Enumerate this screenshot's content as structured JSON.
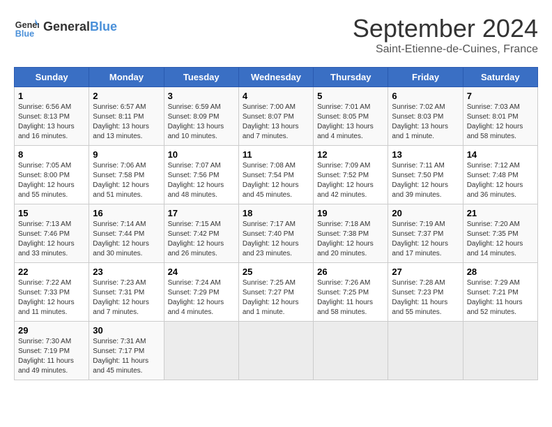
{
  "header": {
    "logo_general": "General",
    "logo_blue": "Blue",
    "title": "September 2024",
    "subtitle": "Saint-Etienne-de-Cuines, France"
  },
  "calendar": {
    "weekdays": [
      "Sunday",
      "Monday",
      "Tuesday",
      "Wednesday",
      "Thursday",
      "Friday",
      "Saturday"
    ],
    "weeks": [
      [
        {
          "day": "1",
          "info": "Sunrise: 6:56 AM\nSunset: 8:13 PM\nDaylight: 13 hours\nand 16 minutes."
        },
        {
          "day": "2",
          "info": "Sunrise: 6:57 AM\nSunset: 8:11 PM\nDaylight: 13 hours\nand 13 minutes."
        },
        {
          "day": "3",
          "info": "Sunrise: 6:59 AM\nSunset: 8:09 PM\nDaylight: 13 hours\nand 10 minutes."
        },
        {
          "day": "4",
          "info": "Sunrise: 7:00 AM\nSunset: 8:07 PM\nDaylight: 13 hours\nand 7 minutes."
        },
        {
          "day": "5",
          "info": "Sunrise: 7:01 AM\nSunset: 8:05 PM\nDaylight: 13 hours\nand 4 minutes."
        },
        {
          "day": "6",
          "info": "Sunrise: 7:02 AM\nSunset: 8:03 PM\nDaylight: 13 hours\nand 1 minute."
        },
        {
          "day": "7",
          "info": "Sunrise: 7:03 AM\nSunset: 8:01 PM\nDaylight: 12 hours\nand 58 minutes."
        }
      ],
      [
        {
          "day": "8",
          "info": "Sunrise: 7:05 AM\nSunset: 8:00 PM\nDaylight: 12 hours\nand 55 minutes."
        },
        {
          "day": "9",
          "info": "Sunrise: 7:06 AM\nSunset: 7:58 PM\nDaylight: 12 hours\nand 51 minutes."
        },
        {
          "day": "10",
          "info": "Sunrise: 7:07 AM\nSunset: 7:56 PM\nDaylight: 12 hours\nand 48 minutes."
        },
        {
          "day": "11",
          "info": "Sunrise: 7:08 AM\nSunset: 7:54 PM\nDaylight: 12 hours\nand 45 minutes."
        },
        {
          "day": "12",
          "info": "Sunrise: 7:09 AM\nSunset: 7:52 PM\nDaylight: 12 hours\nand 42 minutes."
        },
        {
          "day": "13",
          "info": "Sunrise: 7:11 AM\nSunset: 7:50 PM\nDaylight: 12 hours\nand 39 minutes."
        },
        {
          "day": "14",
          "info": "Sunrise: 7:12 AM\nSunset: 7:48 PM\nDaylight: 12 hours\nand 36 minutes."
        }
      ],
      [
        {
          "day": "15",
          "info": "Sunrise: 7:13 AM\nSunset: 7:46 PM\nDaylight: 12 hours\nand 33 minutes."
        },
        {
          "day": "16",
          "info": "Sunrise: 7:14 AM\nSunset: 7:44 PM\nDaylight: 12 hours\nand 30 minutes."
        },
        {
          "day": "17",
          "info": "Sunrise: 7:15 AM\nSunset: 7:42 PM\nDaylight: 12 hours\nand 26 minutes."
        },
        {
          "day": "18",
          "info": "Sunrise: 7:17 AM\nSunset: 7:40 PM\nDaylight: 12 hours\nand 23 minutes."
        },
        {
          "day": "19",
          "info": "Sunrise: 7:18 AM\nSunset: 7:38 PM\nDaylight: 12 hours\nand 20 minutes."
        },
        {
          "day": "20",
          "info": "Sunrise: 7:19 AM\nSunset: 7:37 PM\nDaylight: 12 hours\nand 17 minutes."
        },
        {
          "day": "21",
          "info": "Sunrise: 7:20 AM\nSunset: 7:35 PM\nDaylight: 12 hours\nand 14 minutes."
        }
      ],
      [
        {
          "day": "22",
          "info": "Sunrise: 7:22 AM\nSunset: 7:33 PM\nDaylight: 12 hours\nand 11 minutes."
        },
        {
          "day": "23",
          "info": "Sunrise: 7:23 AM\nSunset: 7:31 PM\nDaylight: 12 hours\nand 7 minutes."
        },
        {
          "day": "24",
          "info": "Sunrise: 7:24 AM\nSunset: 7:29 PM\nDaylight: 12 hours\nand 4 minutes."
        },
        {
          "day": "25",
          "info": "Sunrise: 7:25 AM\nSunset: 7:27 PM\nDaylight: 12 hours\nand 1 minute."
        },
        {
          "day": "26",
          "info": "Sunrise: 7:26 AM\nSunset: 7:25 PM\nDaylight: 11 hours\nand 58 minutes."
        },
        {
          "day": "27",
          "info": "Sunrise: 7:28 AM\nSunset: 7:23 PM\nDaylight: 11 hours\nand 55 minutes."
        },
        {
          "day": "28",
          "info": "Sunrise: 7:29 AM\nSunset: 7:21 PM\nDaylight: 11 hours\nand 52 minutes."
        }
      ],
      [
        {
          "day": "29",
          "info": "Sunrise: 7:30 AM\nSunset: 7:19 PM\nDaylight: 11 hours\nand 49 minutes."
        },
        {
          "day": "30",
          "info": "Sunrise: 7:31 AM\nSunset: 7:17 PM\nDaylight: 11 hours\nand 45 minutes."
        },
        {
          "day": "",
          "info": ""
        },
        {
          "day": "",
          "info": ""
        },
        {
          "day": "",
          "info": ""
        },
        {
          "day": "",
          "info": ""
        },
        {
          "day": "",
          "info": ""
        }
      ]
    ]
  }
}
